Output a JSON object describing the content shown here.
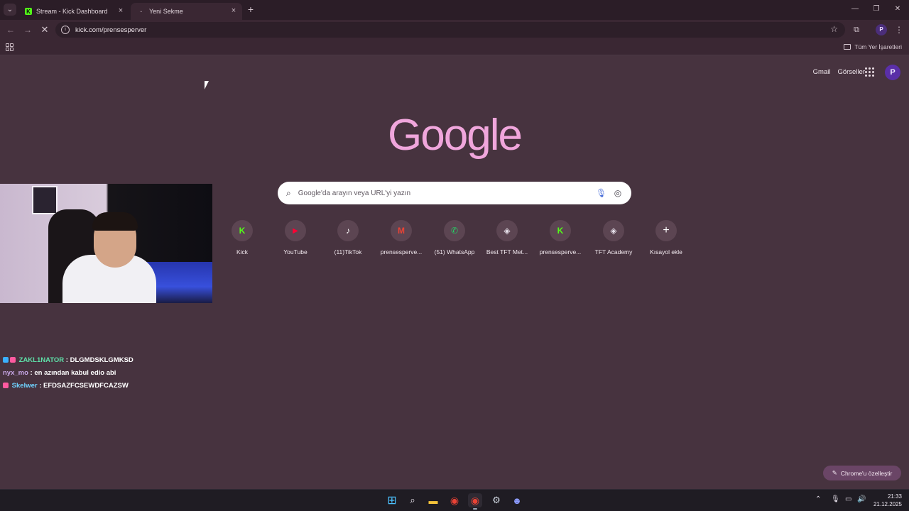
{
  "browser": {
    "tabs": [
      {
        "title": "Stream - Kick Dashboard",
        "favicon": "kick-icon",
        "active": false
      },
      {
        "title": "Yeni Sekme",
        "favicon": "loading-icon",
        "active": true
      }
    ],
    "address_bar": {
      "url": "kick.com/prensesperver"
    },
    "bookmarks_bar": {
      "all_bookmarks_label": "Tüm Yer İşaretleri"
    },
    "profile_initial": "P"
  },
  "ntp": {
    "header_links": {
      "gmail": "Gmail",
      "images": "Görseller"
    },
    "profile_initial": "P",
    "logo_text": "Google",
    "search_placeholder": "Google'da arayın veya URL'yi yazın",
    "shortcuts": [
      {
        "label": "Kick",
        "icon": "kick-icon",
        "color": "#53fc18"
      },
      {
        "label": "YouTube",
        "icon": "youtube-icon",
        "color": "#ff0033"
      },
      {
        "label": "(11)TikTok",
        "icon": "tiktok-icon",
        "color": "#ffffff"
      },
      {
        "label": "prensesperve...",
        "icon": "gmail-icon",
        "color": "#ea4335"
      },
      {
        "label": "(51) WhatsApp",
        "icon": "whatsapp-icon",
        "color": "#25d366"
      },
      {
        "label": "Best TFT Met...",
        "icon": "tft-icon",
        "color": "#e6e0ea"
      },
      {
        "label": "prensesperve...",
        "icon": "kick-icon",
        "color": "#53fc18"
      },
      {
        "label": "TFT Academy",
        "icon": "tft-icon",
        "color": "#e6e0ea"
      },
      {
        "label": "Kısayol ekle",
        "icon": "plus-icon",
        "color": "#ffffff"
      }
    ],
    "customize_label": "Chrome'u özelleştir"
  },
  "chat": [
    {
      "user": "ZAKL1NATOR",
      "message": "DLGMDSKLGMKSD",
      "user_color": "#5ee0a8"
    },
    {
      "user": "nyx_mo",
      "message": "en azından kabul edio abi",
      "user_color": "#c9a8e8"
    },
    {
      "user": "Skelwer",
      "message": "EFDSAZFCSEWDFCAZSW",
      "user_color": "#6fd3ff"
    }
  ],
  "taskbar": {
    "time": "21:33",
    "date": "21.12.2025"
  }
}
